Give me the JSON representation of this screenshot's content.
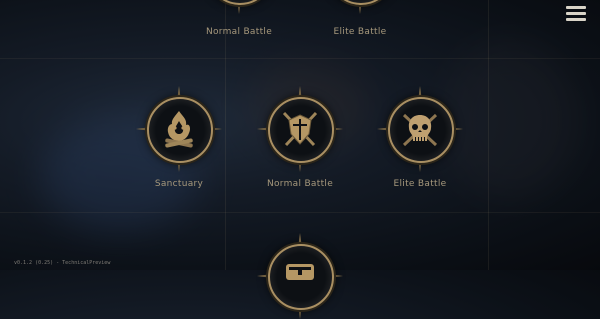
{
  "nodes": {
    "top_left": {
      "label": "Normal Battle",
      "icon": "swords-shield-icon"
    },
    "top_right": {
      "label": "Elite Battle",
      "icon": "skull-crossbones-icon"
    },
    "mid_left": {
      "label": "Sanctuary",
      "icon": "campfire-icon"
    },
    "mid_center": {
      "label": "Normal Battle",
      "icon": "swords-shield-icon"
    },
    "mid_right": {
      "label": "Elite Battle",
      "icon": "skull-crossbones-icon"
    },
    "bottom": {
      "label": "",
      "icon": "chest-icon"
    }
  },
  "menu": {
    "icon": "hamburger-menu-icon"
  },
  "footer": {
    "version": "v0.1.2 (0.25) - TechnicalPreview"
  },
  "colors": {
    "accent": "#a98f62",
    "label": "#a6987c",
    "background": "#0c1118"
  }
}
